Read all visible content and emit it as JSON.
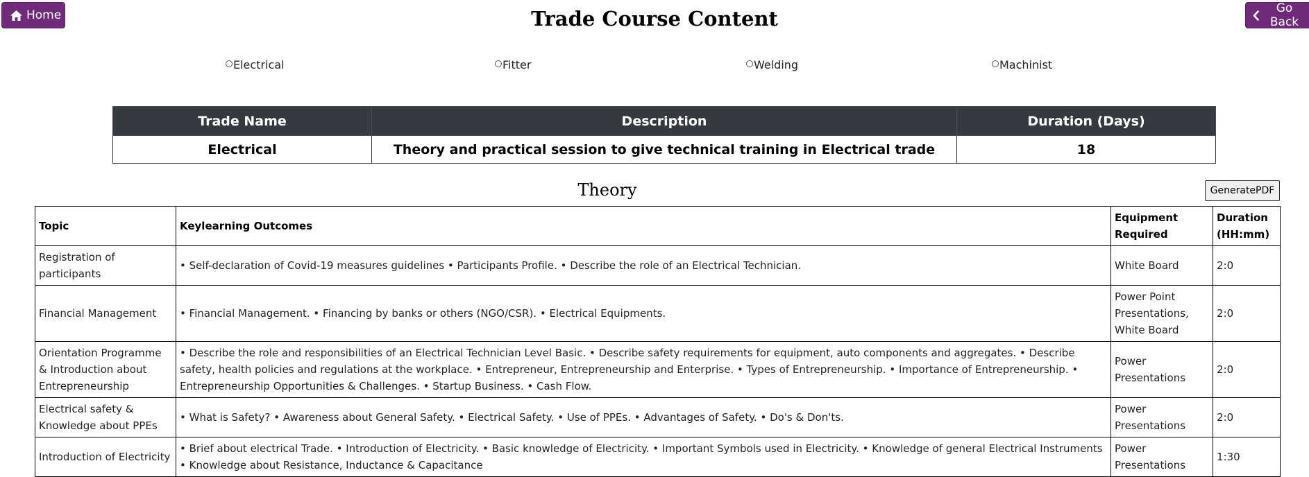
{
  "nav": {
    "home_label": "Home",
    "back_label": "Go Back"
  },
  "page_title": "Trade Course Content",
  "trade_options": [
    {
      "label": "Electrical",
      "selected": false
    },
    {
      "label": "Fitter",
      "selected": false
    },
    {
      "label": "Welding",
      "selected": false
    },
    {
      "label": "Machinist",
      "selected": false
    }
  ],
  "summary": {
    "headers": [
      "Trade Name",
      "Description",
      "Duration (Days)"
    ],
    "row": [
      "Electrical",
      "Theory and practical session to give technical training in Electrical trade",
      "18"
    ]
  },
  "theory": {
    "title": "Theory",
    "generate_pdf_label": "GeneratePDF",
    "headers": [
      "Topic",
      "Keylearning Outcomes",
      "Equipment Required",
      "Duration (HH:mm)"
    ],
    "rows": [
      [
        "Registration of participants",
        "• Self-declaration of Covid-19 measures guidelines • Participants Profile. • Describe the role of an Electrical Technician.",
        "White Board",
        "2:0"
      ],
      [
        "Financial Management",
        "• Financial Management. • Financing by banks or others (NGO/CSR). • Electrical Equipments.",
        "Power Point Presentations, White Board",
        "2:0"
      ],
      [
        "Orientation Programme & Introduction about Entrepreneurship",
        "• Describe the role and responsibilities of an Electrical Technician Level Basic. • Describe safety requirements for equipment, auto components and aggregates. • Describe safety, health policies and regulations at the workplace. • Entrepreneur, Entrepreneurship and Enterprise. • Types of Entrepreneurship. • Importance of Entrepreneurship. • Entrepreneurship Opportunities & Challenges. • Startup Business. • Cash Flow.",
        "Power Presentations",
        "2:0"
      ],
      [
        "Electrical safety & Knowledge about PPEs",
        "• What is Safety? • Awareness about General Safety. • Electrical Safety. • Use of PPEs. • Advantages of Safety. • Do's & Don'ts.",
        "Power Presentations",
        "2:0"
      ],
      [
        "Introduction of Electricity",
        "• Brief about electrical Trade. • Introduction of Electricity. • Basic knowledge of Electricity. • Important Symbols used in Electricity. • Knowledge of general Electrical Instruments • Knowledge about Resistance, Inductance & Capacitance",
        "Power Presentations",
        "1:30"
      ]
    ]
  },
  "icons": {
    "home": "home-icon",
    "back": "chevron-left-icon"
  },
  "colors": {
    "brand": "#6f2a7a",
    "table_header": "#343a40"
  }
}
